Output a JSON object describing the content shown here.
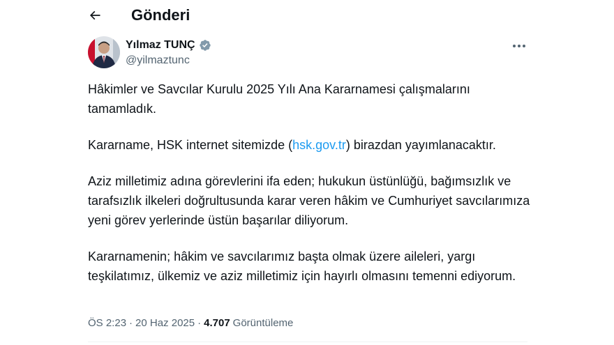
{
  "header": {
    "title": "Gönderi"
  },
  "author": {
    "display_name": "Yılmaz TUNÇ",
    "handle": "@yilmaztunc",
    "verified": true
  },
  "tweet": {
    "paragraphs": {
      "p1": "Hâkimler ve Savcılar Kurulu 2025 Yılı Ana Kararnamesi çalışmalarını tamamladık.",
      "p2_before": "Kararname, HSK internet sitemizde (",
      "p2_link": "hsk.gov.tr",
      "p2_after": ") birazdan yayımlanacaktır.",
      "p3": "Aziz milletimiz adına görevlerini ifa eden; hukukun üstünlüğü, bağımsızlık ve tarafsızlık ilkeleri doğrultusunda karar veren hâkim ve Cumhuriyet savcılarımıza yeni görev yerlerinde üstün başarılar diliyorum.",
      "p4": "Kararnamenin; hâkim ve savcılarımız başta olmak üzere aileleri, yargı teşkilatımız, ülkemiz ve aziz milletimiz için hayırlı olmasını temenni ediyorum."
    }
  },
  "meta": {
    "time": "ÖS 2:23",
    "separator": "·",
    "date": "20 Haz 2025",
    "views_count": "4.707",
    "views_label": "Görüntüleme"
  },
  "icons": {
    "back": "arrow-left-icon",
    "verified": "verified-badge-icon",
    "more": "more-horizontal-icon"
  },
  "colors": {
    "link": "#1d9bf0",
    "secondary_text": "#536471",
    "verified_badge": "#829aab"
  }
}
